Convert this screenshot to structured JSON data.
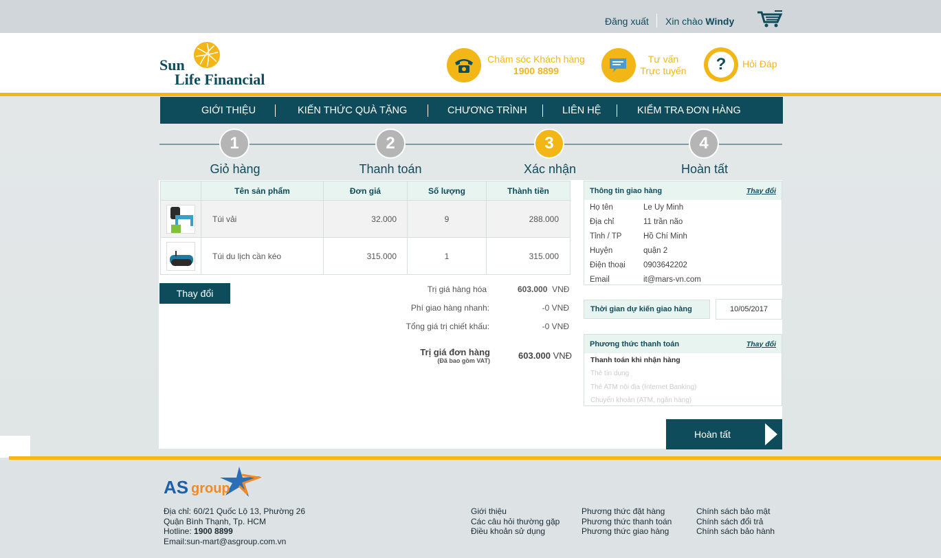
{
  "topbar": {
    "logout": "Đăng xuất",
    "greeting": "Xin chào",
    "username": "Windy"
  },
  "brand": {
    "line1": "Sun",
    "line2": "Life Financial"
  },
  "header_links": [
    {
      "label1": "Chăm sóc Khách hàng",
      "label2": "1900 8899",
      "icon": "phone-icon"
    },
    {
      "label1": "Tư vấn",
      "label2": "Trực tuyến",
      "icon": "chat-icon"
    },
    {
      "label1": "Hỏi Đáp",
      "icon": "question-icon"
    }
  ],
  "nav": [
    "GIỚI THIỆU",
    "KIẾN THỨC QUÀ TẶNG",
    "CHƯƠNG TRÌNH",
    "LIÊN HỆ",
    "KIỂM TRA ĐƠN HÀNG"
  ],
  "steps": [
    {
      "num": "1",
      "label": "Giỏ hàng"
    },
    {
      "num": "2",
      "label": "Thanh toán"
    },
    {
      "num": "3",
      "label": "Xác nhận"
    },
    {
      "num": "4",
      "label": "Hoàn tất"
    }
  ],
  "table": {
    "headers": [
      "Tên sản phẩm",
      "Đơn giá",
      "Số lượng",
      "Thành tiền"
    ],
    "rows": [
      {
        "name": "Túi vải",
        "price": "32.000",
        "qty": "9",
        "total": "288.000"
      },
      {
        "name": "Túi du lịch cần kéo",
        "price": "315.000",
        "qty": "1",
        "total": "315.000"
      }
    ]
  },
  "change_button": "Thay đổi",
  "summary": {
    "goods_label": "Trị giá hàng hóa",
    "goods_value": "603.000",
    "goods_unit": "VNĐ",
    "ship_label": "Phí giao hàng nhanh:",
    "ship_value": "-0 VNĐ",
    "discount_label": "Tổng giá trị chiết khấu:",
    "discount_value": "-0 VNĐ",
    "order_label": "Trị giá đơn hàng",
    "order_note": "(Đã bao gồm VAT)",
    "order_value": "603.000",
    "order_unit": "VNĐ"
  },
  "shipping": {
    "title": "Thông tin giao hàng",
    "change": "Thay đổi",
    "rows": [
      {
        "k": "Họ tên",
        "v": "Le Uy Minh"
      },
      {
        "k": "Địa chỉ",
        "v": "11 trần não"
      },
      {
        "k": "Tỉnh / TP",
        "v": "Hồ Chí Minh"
      },
      {
        "k": "Huyện",
        "v": "quận 2"
      },
      {
        "k": "Điện thoại",
        "v": "0903642202"
      },
      {
        "k": "Email",
        "v": "it@mars-vn.com"
      }
    ]
  },
  "delivery": {
    "label": "Thời gian dự kiến giao hàng",
    "date": "10/05/2017"
  },
  "payment": {
    "title": "Phương thức thanh toán",
    "change": "Thay đổi",
    "selected": "Thanh toán khi nhận hàng",
    "options": [
      "Thẻ tín dụng",
      "Thẻ ATM nội địa (Internet Banking)",
      "Chuyển khoản (ATM, ngân hàng)"
    ]
  },
  "finish_button": "Hoàn tất",
  "footer": {
    "logo_as": "AS",
    "logo_group": "group",
    "address1": "Địa chỉ: 60/21 Quốc Lộ 13, Phường 26",
    "address2": "Quận Bình Thạnh, Tp. HCM",
    "hotline_label": "Hotline:",
    "hotline": "1900 8899",
    "email": "Email:sun-mart@asgroup.com.vn",
    "col1": [
      "Giới thiệu",
      "Các câu hỏi thường gặp",
      "Điều khoản sử dụng"
    ],
    "col2": [
      "Phương thức đặt hàng",
      "Phương thức thanh toán",
      "Phương thức giao hàng"
    ],
    "col3": [
      "Chính sách bảo mật",
      "Chính sách đổi trả",
      "Chính sách bảo hành"
    ]
  },
  "colors": {
    "primary": "#0e4c5c",
    "accent": "#f2b616",
    "step_inactive": "#b5b5b5"
  }
}
